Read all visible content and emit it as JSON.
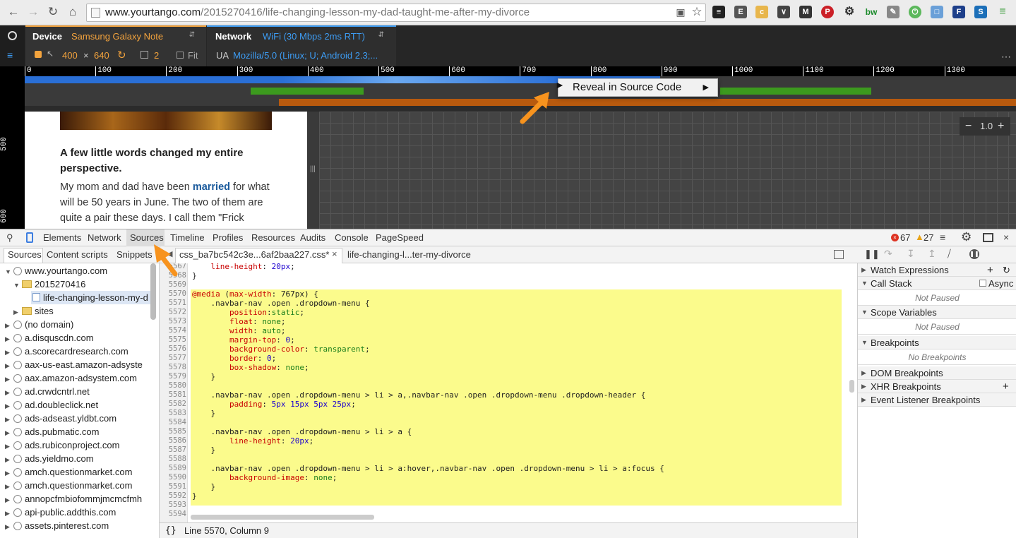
{
  "browser": {
    "url_host": "www.yourtango.com",
    "url_path": "/2015270416/life-changing-lesson-my-dad-taught-me-after-my-divorce"
  },
  "emulation": {
    "device_label": "Device",
    "device_value": "Samsung Galaxy Note",
    "width": "400",
    "times": "×",
    "height": "640",
    "pixel_ratio": "2",
    "fit_label": "Fit",
    "network_label": "Network",
    "network_value": "WiFi (30 Mbps 2ms RTT)",
    "ua_label": "UA",
    "ua_value": "Mozilla/5.0 (Linux; U; Android 2.3;..."
  },
  "ruler": {
    "top_ticks": [
      "0",
      "100",
      "200",
      "300",
      "400",
      "500",
      "600",
      "700",
      "800",
      "900",
      "1000",
      "1100",
      "1200",
      "1300"
    ],
    "left_ticks": [
      "500",
      "600"
    ],
    "zoom": "1.0"
  },
  "page": {
    "heading": "A few little words changed my entire perspective.",
    "para_before": "My mom and dad have been ",
    "para_link": "married",
    "para_after": " for what will be 50 years in June. The two of them are quite a pair these days. I call them \"Frick"
  },
  "context_menu": {
    "item": "Reveal in Source Code"
  },
  "devtools": {
    "tabs": [
      "Elements",
      "Network",
      "Sources",
      "Timeline",
      "Profiles",
      "Resources",
      "Audits",
      "Console",
      "PageSpeed"
    ],
    "errors": "67",
    "warnings": "27",
    "subtabs": [
      "Sources",
      "Content scripts",
      "Snippets"
    ],
    "file_tabs": [
      "css_ba7bc542c3e...6af2baa227.css*",
      "life-changing-l...ter-my-divorce"
    ]
  },
  "navigator": {
    "items": [
      {
        "label": "www.yourtango.com",
        "kind": "globe",
        "expanded": true,
        "indent": 0
      },
      {
        "label": "2015270416",
        "kind": "folder",
        "expanded": true,
        "indent": 1
      },
      {
        "label": "life-changing-lesson-my-d",
        "kind": "file",
        "expanded": false,
        "indent": 2
      },
      {
        "label": "sites",
        "kind": "folder",
        "expanded": false,
        "indent": 1
      },
      {
        "label": "(no domain)",
        "kind": "globe",
        "expanded": false,
        "indent": 0
      },
      {
        "label": "a.disquscdn.com",
        "kind": "globe",
        "expanded": false,
        "indent": 0
      },
      {
        "label": "a.scorecardresearch.com",
        "kind": "globe",
        "expanded": false,
        "indent": 0
      },
      {
        "label": "aax-us-east.amazon-adsyste",
        "kind": "globe",
        "expanded": false,
        "indent": 0
      },
      {
        "label": "aax.amazon-adsystem.com",
        "kind": "globe",
        "expanded": false,
        "indent": 0
      },
      {
        "label": "ad.crwdcntrl.net",
        "kind": "globe",
        "expanded": false,
        "indent": 0
      },
      {
        "label": "ad.doubleclick.net",
        "kind": "globe",
        "expanded": false,
        "indent": 0
      },
      {
        "label": "ads-adseast.yldbt.com",
        "kind": "globe",
        "expanded": false,
        "indent": 0
      },
      {
        "label": "ads.pubmatic.com",
        "kind": "globe",
        "expanded": false,
        "indent": 0
      },
      {
        "label": "ads.rubiconproject.com",
        "kind": "globe",
        "expanded": false,
        "indent": 0
      },
      {
        "label": "ads.yieldmo.com",
        "kind": "globe",
        "expanded": false,
        "indent": 0
      },
      {
        "label": "amch.questionmarket.com",
        "kind": "globe",
        "expanded": false,
        "indent": 0
      },
      {
        "label": "amch.questionmarket.com",
        "kind": "globe",
        "expanded": false,
        "indent": 0
      },
      {
        "label": "annopcfmbiofommjmcmcfmh",
        "kind": "globe",
        "expanded": false,
        "indent": 0
      },
      {
        "label": "api-public.addthis.com",
        "kind": "globe",
        "expanded": false,
        "indent": 0
      },
      {
        "label": "assets.pinterest.com",
        "kind": "globe",
        "expanded": false,
        "indent": 0
      }
    ]
  },
  "editor": {
    "lines": [
      {
        "n": "5567",
        "t": "    line-height: 20px;"
      },
      {
        "n": "5568",
        "t": "}"
      },
      {
        "n": "5569",
        "t": ""
      },
      {
        "n": "5570",
        "t": "@media (max-width: 767px) {"
      },
      {
        "n": "5571",
        "t": "    .navbar-nav .open .dropdown-menu {"
      },
      {
        "n": "5572",
        "t": "        position:static;"
      },
      {
        "n": "5573",
        "t": "        float: none;"
      },
      {
        "n": "5574",
        "t": "        width: auto;"
      },
      {
        "n": "5575",
        "t": "        margin-top: 0;"
      },
      {
        "n": "5576",
        "t": "        background-color: transparent;"
      },
      {
        "n": "5577",
        "t": "        border: 0;"
      },
      {
        "n": "5578",
        "t": "        box-shadow: none;"
      },
      {
        "n": "5579",
        "t": "    }"
      },
      {
        "n": "5580",
        "t": ""
      },
      {
        "n": "5581",
        "t": "    .navbar-nav .open .dropdown-menu > li > a,.navbar-nav .open .dropdown-menu .dropdown-header {"
      },
      {
        "n": "5582",
        "t": "        padding: 5px 15px 5px 25px;"
      },
      {
        "n": "5583",
        "t": "    }"
      },
      {
        "n": "5584",
        "t": ""
      },
      {
        "n": "5585",
        "t": "    .navbar-nav .open .dropdown-menu > li > a {"
      },
      {
        "n": "5586",
        "t": "        line-height: 20px;"
      },
      {
        "n": "5587",
        "t": "    }"
      },
      {
        "n": "5588",
        "t": ""
      },
      {
        "n": "5589",
        "t": "    .navbar-nav .open .dropdown-menu > li > a:hover,.navbar-nav .open .dropdown-menu > li > a:focus {"
      },
      {
        "n": "5590",
        "t": "        background-image: none;"
      },
      {
        "n": "5591",
        "t": "    }"
      },
      {
        "n": "5592",
        "t": "}"
      },
      {
        "n": "5593",
        "t": ""
      },
      {
        "n": "5594",
        "t": ""
      }
    ],
    "status": "Line 5570, Column 9",
    "format_icon": "{}"
  },
  "debugger": {
    "watch": "Watch Expressions",
    "call_stack": "Call Stack",
    "async": "Async",
    "not_paused_1": "Not Paused",
    "scope": "Scope Variables",
    "not_paused_2": "Not Paused",
    "breakpoints": "Breakpoints",
    "no_breakpoints": "No Breakpoints",
    "dom_bp": "DOM Breakpoints",
    "xhr_bp": "XHR Breakpoints",
    "event_bp": "Event Listener Breakpoints"
  },
  "colors": {
    "accent_orange": "#f3a33d",
    "accent_blue": "#3d9cf3",
    "highlight": "#fbfb8c",
    "annotation_arrow": "#f7931e"
  }
}
